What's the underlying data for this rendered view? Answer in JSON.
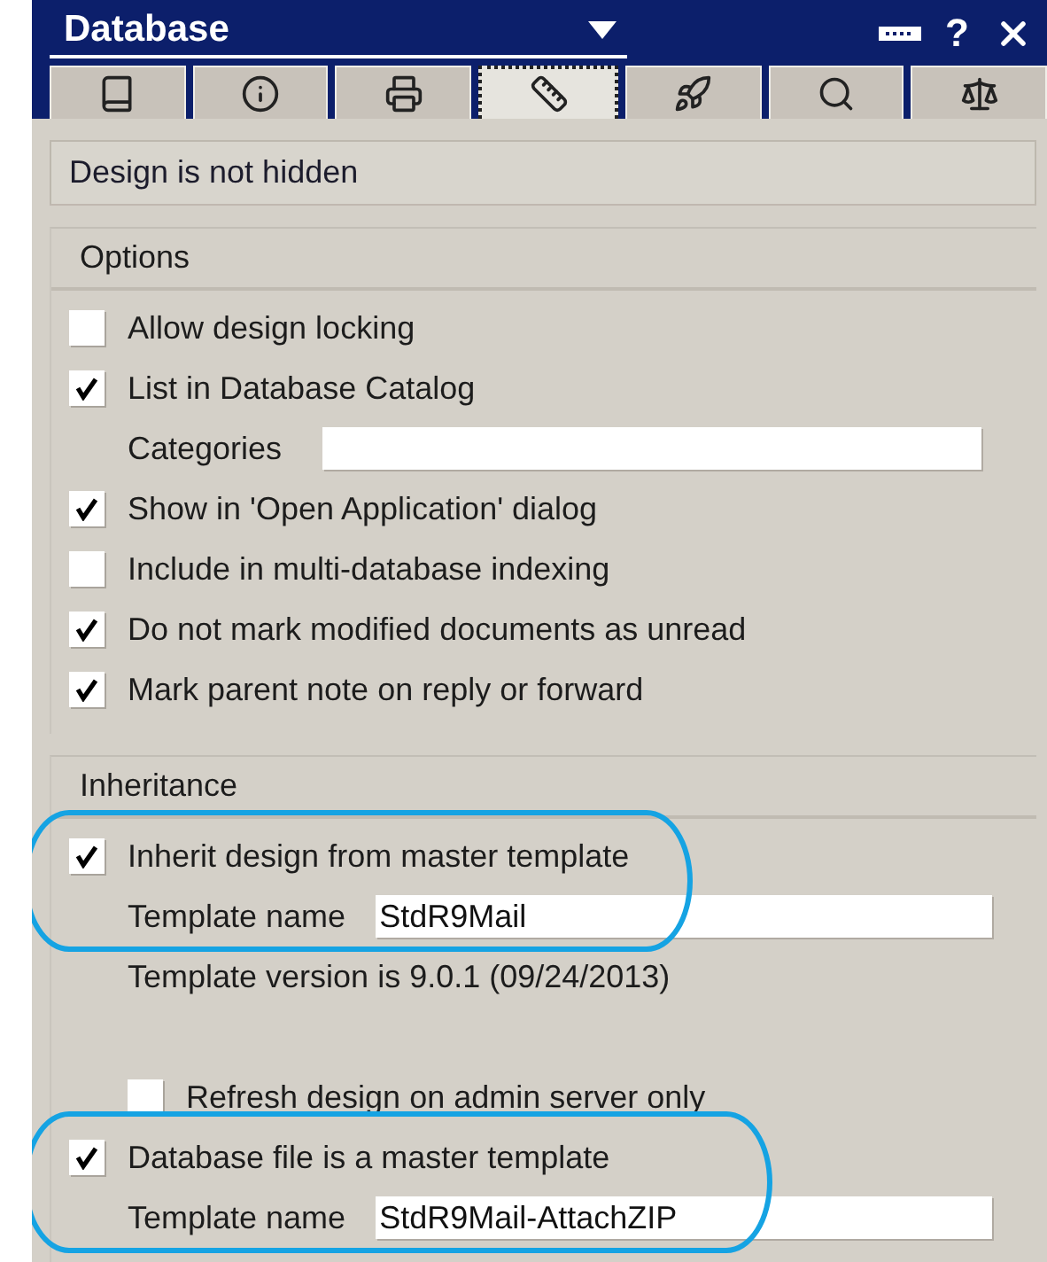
{
  "window": {
    "title": "Database",
    "help_label": "?"
  },
  "tabs": [
    {
      "kind": "book",
      "selected": false
    },
    {
      "kind": "info",
      "selected": false
    },
    {
      "kind": "printer",
      "selected": false
    },
    {
      "kind": "ruler",
      "selected": true
    },
    {
      "kind": "rocket",
      "selected": false
    },
    {
      "kind": "search",
      "selected": false
    },
    {
      "kind": "scale",
      "selected": false
    }
  ],
  "status": "Design is not hidden",
  "sections": [
    {
      "title": "Options",
      "items": [
        {
          "kind": "checkbox",
          "label": "Allow design locking",
          "checked": false
        },
        {
          "kind": "checkbox",
          "label": "List in Database Catalog",
          "checked": true,
          "children": [
            {
              "kind": "field",
              "label": "Categories"
            }
          ]
        },
        {
          "kind": "checkbox",
          "label": "Show in 'Open Application' dialog",
          "checked": true
        },
        {
          "kind": "checkbox",
          "label": "Include in multi-database indexing",
          "checked": false
        },
        {
          "kind": "checkbox",
          "label": "Do not mark modified documents as unread",
          "checked": true
        },
        {
          "kind": "checkbox",
          "label": "Mark parent note on reply or forward",
          "checked": true
        }
      ]
    },
    {
      "title": "Inheritance",
      "items": [
        {
          "kind": "checkbox",
          "label": "Inherit design from master template",
          "checked": true,
          "highlighted": true,
          "children": [
            {
              "kind": "field",
              "label": "Template name",
              "value": "StdR9Mail"
            },
            {
              "kind": "text",
              "label": "Template version is 9.0.1 (09/24/2013)"
            },
            {
              "kind": "checkbox",
              "label": "Refresh design on admin server only",
              "checked": false
            }
          ]
        },
        {
          "kind": "checkbox",
          "label": "Database file is a master template",
          "checked": true,
          "highlighted": true,
          "children": [
            {
              "kind": "field",
              "label": "Template name",
              "value": "StdR9Mail-AttachZIP"
            }
          ]
        }
      ]
    }
  ]
}
